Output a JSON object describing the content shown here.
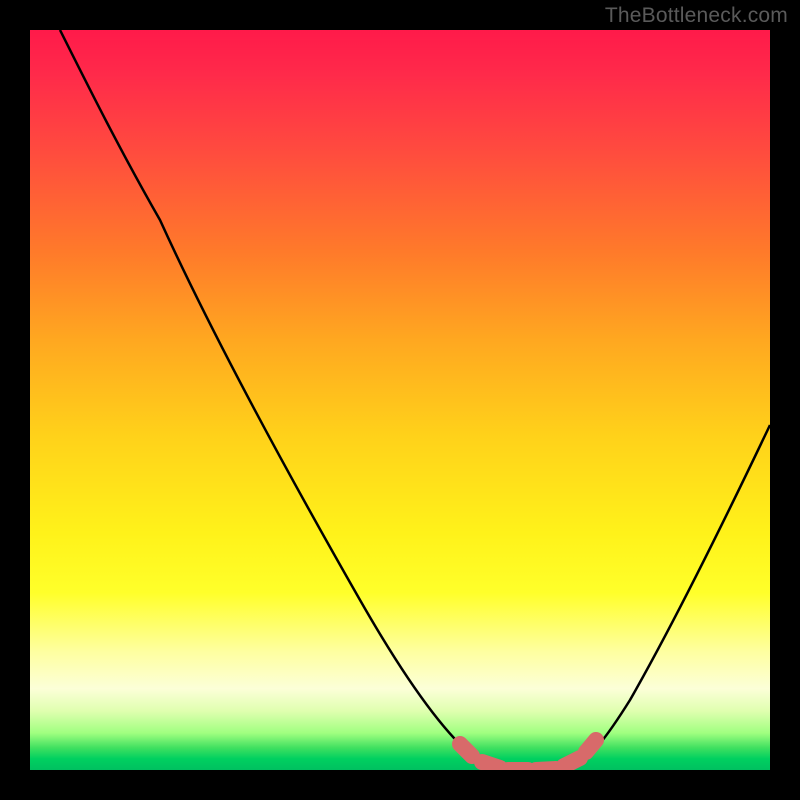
{
  "watermark": "TheBottleneck.com",
  "colors": {
    "frame": "#000000",
    "curve": "#000000",
    "flat_segment": "#d86a6a"
  },
  "chart_data": {
    "type": "line",
    "title": "",
    "xlabel": "",
    "ylabel": "",
    "xlim": [
      0,
      100
    ],
    "ylim": [
      0,
      100
    ],
    "series": [
      {
        "name": "bottleneck-curve",
        "x": [
          0,
          6,
          12,
          18,
          24,
          30,
          36,
          42,
          48,
          52,
          56,
          60,
          64,
          68,
          72,
          76,
          82,
          88,
          94,
          100
        ],
        "y": [
          100,
          92,
          83,
          74,
          65,
          56,
          47,
          38,
          28,
          20,
          12,
          5,
          1,
          0,
          0,
          1,
          8,
          20,
          35,
          52
        ]
      },
      {
        "name": "optimal-flat-region",
        "x": [
          59,
          62,
          66,
          70,
          74,
          77
        ],
        "y": [
          4,
          1,
          0,
          0,
          1,
          4
        ]
      }
    ],
    "annotations": []
  }
}
